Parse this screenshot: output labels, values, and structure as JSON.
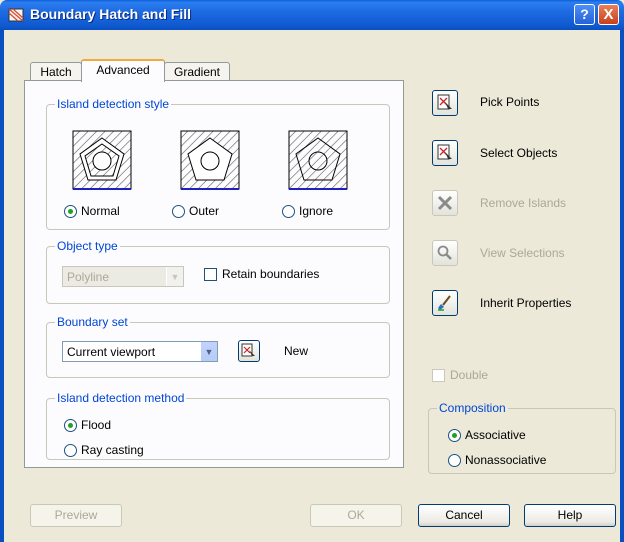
{
  "window": {
    "title": "Boundary Hatch and Fill",
    "help_glyph": "?",
    "close_glyph": "X"
  },
  "tabs": [
    {
      "label": "Hatch",
      "active": false
    },
    {
      "label": "Advanced",
      "active": true
    },
    {
      "label": "Gradient",
      "active": false
    }
  ],
  "island_detection_style": {
    "title": "Island detection style",
    "options": [
      {
        "label": "Normal",
        "selected": true
      },
      {
        "label": "Outer",
        "selected": false
      },
      {
        "label": "Ignore",
        "selected": false
      }
    ]
  },
  "object_type": {
    "title": "Object type",
    "select_value": "Polyline",
    "retain_boundaries_label": "Retain boundaries",
    "retain_boundaries_checked": false
  },
  "boundary_set": {
    "title": "Boundary set",
    "select_value": "Current viewport",
    "new_label": "New"
  },
  "island_detection_method": {
    "title": "Island detection method",
    "options": [
      {
        "label": "Flood",
        "selected": true
      },
      {
        "label": "Ray casting",
        "selected": false
      }
    ]
  },
  "actions": {
    "pick_points": "Pick Points",
    "select_objects": "Select Objects",
    "remove_islands": "Remove Islands",
    "view_selections": "View Selections",
    "inherit_properties": "Inherit Properties"
  },
  "double": {
    "label": "Double",
    "checked": false,
    "enabled": false
  },
  "composition": {
    "title": "Composition",
    "options": [
      {
        "label": "Associative",
        "selected": true
      },
      {
        "label": "Nonassociative",
        "selected": false
      }
    ]
  },
  "footer": {
    "preview": "Preview",
    "ok": "OK",
    "cancel": "Cancel",
    "help": "Help"
  },
  "colors": {
    "title_bar": "#0a5fd8",
    "group_title": "#0046d5",
    "dialog_bg": "#ece9d8",
    "tab_accent": "#f1a93d"
  }
}
